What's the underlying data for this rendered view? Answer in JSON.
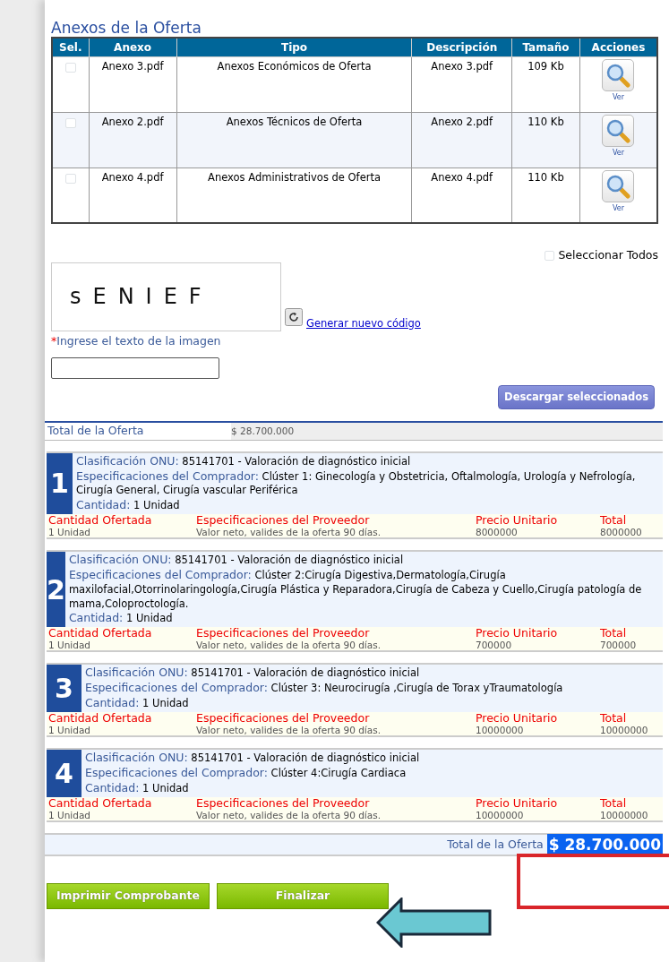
{
  "annex_section": {
    "title": "Anexos de la Oferta",
    "columns": [
      "Sel.",
      "Anexo",
      "Tipo",
      "Descripción",
      "Tamaño",
      "Acciones"
    ],
    "rows": [
      {
        "checked": false,
        "file": "Anexo 3.pdf",
        "type": "Anexos Económicos de Oferta",
        "description": "Anexo 3.pdf",
        "size": "109 Kb",
        "action": "Ver"
      },
      {
        "checked": false,
        "file": "Anexo 2.pdf",
        "type": "Anexos Técnicos de Oferta",
        "description": "Anexo 2.pdf",
        "size": "110 Kb",
        "action": "Ver"
      },
      {
        "checked": false,
        "file": "Anexo 4.pdf",
        "type": "Anexos Administrativos de Oferta",
        "description": "Anexo 4.pdf",
        "size": "110 Kb",
        "action": "Ver"
      }
    ],
    "select_all": {
      "label": "Seleccionar Todos",
      "checked": false
    }
  },
  "captcha": {
    "text": "sENIEF",
    "refresh_link": "Generar nuevo código",
    "required_mark": "*",
    "label": "Ingrese el texto de la imagen"
  },
  "download_button": "Descargar seleccionados",
  "summary": {
    "label": "Total de la Oferta",
    "value": "$ 28.700.000"
  },
  "items": [
    {
      "number": "1",
      "classification_label": "Clasificación ONU:",
      "classification": "85141701 - Valoración de diagnóstico inicial",
      "buyer_spec_label": "Especificaciones del Comprador:",
      "buyer_spec": "Clúster 1: Ginecología y Obstetricia, Oftalmología, Urología y Nefrología, Cirugía General, Cirugía vascular Periférica",
      "quantity_label": "Cantidad:",
      "quantity": "1 Unidad",
      "offer_headers": [
        "Cantidad Ofertada",
        "Especificaciones del Proveedor",
        "Precio Unitario",
        "Total"
      ],
      "offer_values": [
        "1 Unidad",
        "Valor neto, valides de la oferta 90 días.",
        "8000000",
        "8000000"
      ]
    },
    {
      "number": "2",
      "classification_label": "Clasificación ONU:",
      "classification": "85141701 - Valoración de diagnóstico inicial",
      "buyer_spec_label": "Especificaciones del Comprador:",
      "buyer_spec": "Clúster 2:Cirugía Digestiva,Dermatología,Cirugía maxilofacial,Otorrinolaringología,Cirugía Plástica y Reparadora,Cirugía de Cabeza y Cuello,Cirugía patología de mama,Coloproctología.",
      "quantity_label": "Cantidad:",
      "quantity": "1 Unidad",
      "offer_headers": [
        "Cantidad Ofertada",
        "Especificaciones del Proveedor",
        "Precio Unitario",
        "Total"
      ],
      "offer_values": [
        "1 Unidad",
        "Valor neto, valides de la oferta 90 días.",
        "700000",
        "700000"
      ]
    },
    {
      "number": "3",
      "classification_label": "Clasificación ONU:",
      "classification": "85141701 - Valoración de diagnóstico inicial",
      "buyer_spec_label": "Especificaciones del Comprador:",
      "buyer_spec": "Clúster 3: Neurocirugía ,Cirugía de Torax yTraumatología",
      "quantity_label": "Cantidad:",
      "quantity": "1 Unidad",
      "offer_headers": [
        "Cantidad Ofertada",
        "Especificaciones del Proveedor",
        "Precio Unitario",
        "Total"
      ],
      "offer_values": [
        "1 Unidad",
        "Valor neto, valides de la oferta 90 días.",
        "10000000",
        "10000000"
      ]
    },
    {
      "number": "4",
      "classification_label": "Clasificación ONU:",
      "classification": "85141701 - Valoración de diagnóstico inicial",
      "buyer_spec_label": "Especificaciones del Comprador:",
      "buyer_spec": "Clúster 4:Cirugía Cardiaca",
      "quantity_label": "Cantidad:",
      "quantity": "1 Unidad",
      "offer_headers": [
        "Cantidad Ofertada",
        "Especificaciones del Proveedor",
        "Precio Unitario",
        "Total"
      ],
      "offer_values": [
        "1 Unidad",
        "Valor neto, valides de la oferta 90 días.",
        "10000000",
        "10000000"
      ]
    }
  ],
  "grand_total": {
    "label": "Total de la Oferta",
    "value": "$ 28.700.000",
    "selected": true
  },
  "buttons": [
    "Imprimir Comprobante",
    "Finalizar"
  ]
}
